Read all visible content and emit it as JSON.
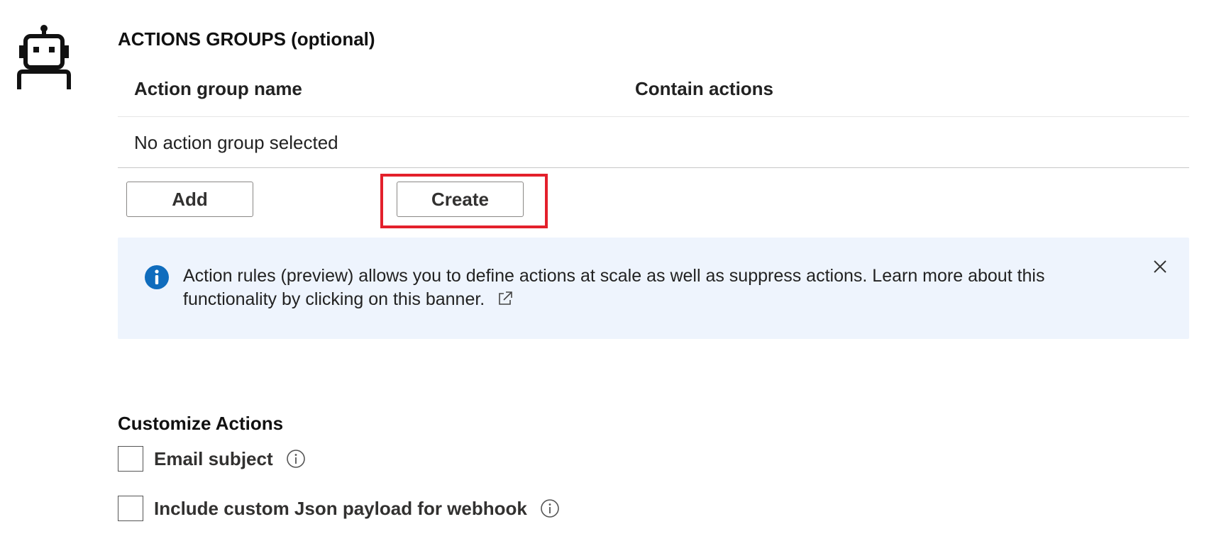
{
  "actions_groups": {
    "title": "ACTIONS GROUPS (optional)",
    "icon": "robot-icon",
    "columns": [
      "Action group name",
      "Contain actions"
    ],
    "empty_row_text": "No action group selected",
    "add_label": "Add",
    "create_label": "Create"
  },
  "banner": {
    "icon": "info-icon",
    "text": "Action rules (preview) allows you to define actions at scale as well as suppress actions. Learn more about this functionality by clicking on this banner.",
    "link_icon": "external-link-icon",
    "close_icon": "close-icon"
  },
  "customize": {
    "title": "Customize Actions",
    "options": [
      {
        "label": "Email subject",
        "checked": false
      },
      {
        "label": "Include custom Json payload for webhook",
        "checked": false
      }
    ]
  },
  "colors": {
    "highlight": "#e3202b",
    "banner_bg": "#eef4fd",
    "info_blue": "#0f6cbd"
  }
}
